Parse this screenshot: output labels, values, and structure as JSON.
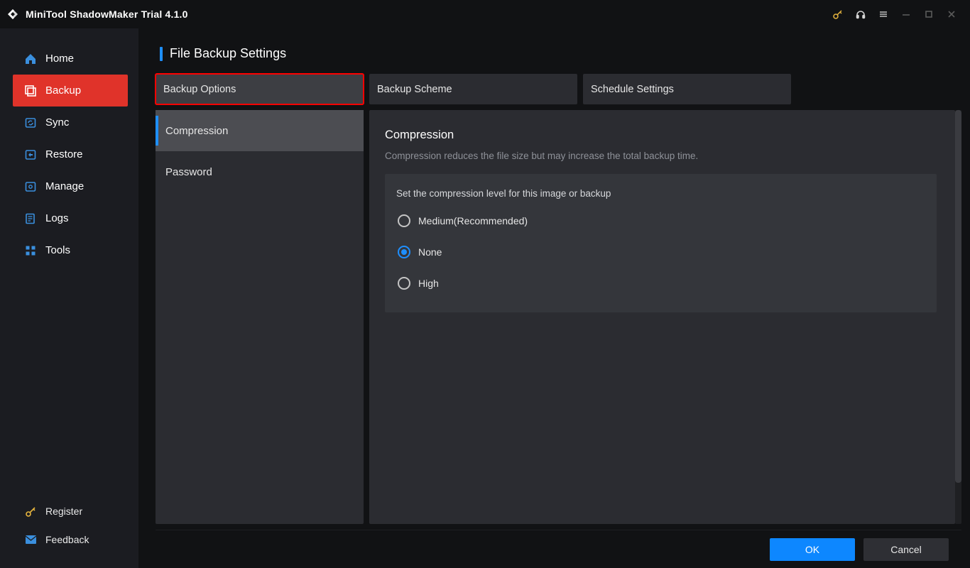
{
  "app_title": "MiniTool ShadowMaker Trial 4.1.0",
  "sidebar": {
    "items": [
      {
        "label": "Home",
        "icon": "home-icon"
      },
      {
        "label": "Backup",
        "icon": "backup-icon"
      },
      {
        "label": "Sync",
        "icon": "sync-icon"
      },
      {
        "label": "Restore",
        "icon": "restore-icon"
      },
      {
        "label": "Manage",
        "icon": "manage-icon"
      },
      {
        "label": "Logs",
        "icon": "logs-icon"
      },
      {
        "label": "Tools",
        "icon": "tools-icon"
      }
    ],
    "bottom": [
      {
        "label": "Register",
        "icon": "key-icon"
      },
      {
        "label": "Feedback",
        "icon": "mail-icon"
      }
    ]
  },
  "page": {
    "title": "File Backup Settings",
    "tabs": [
      {
        "label": "Backup Options",
        "active": true
      },
      {
        "label": "Backup Scheme",
        "active": false
      },
      {
        "label": "Schedule Settings",
        "active": false
      }
    ],
    "option_list": [
      {
        "label": "Compression",
        "active": true
      },
      {
        "label": "Password",
        "active": false
      }
    ],
    "panel": {
      "heading": "Compression",
      "description": "Compression reduces the file size but may increase the total backup time.",
      "box_title": "Set the compression level for this image or backup",
      "options": [
        {
          "label": "Medium(Recommended)",
          "selected": false
        },
        {
          "label": "None",
          "selected": true
        },
        {
          "label": "High",
          "selected": false
        }
      ]
    }
  },
  "footer": {
    "ok": "OK",
    "cancel": "Cancel"
  }
}
